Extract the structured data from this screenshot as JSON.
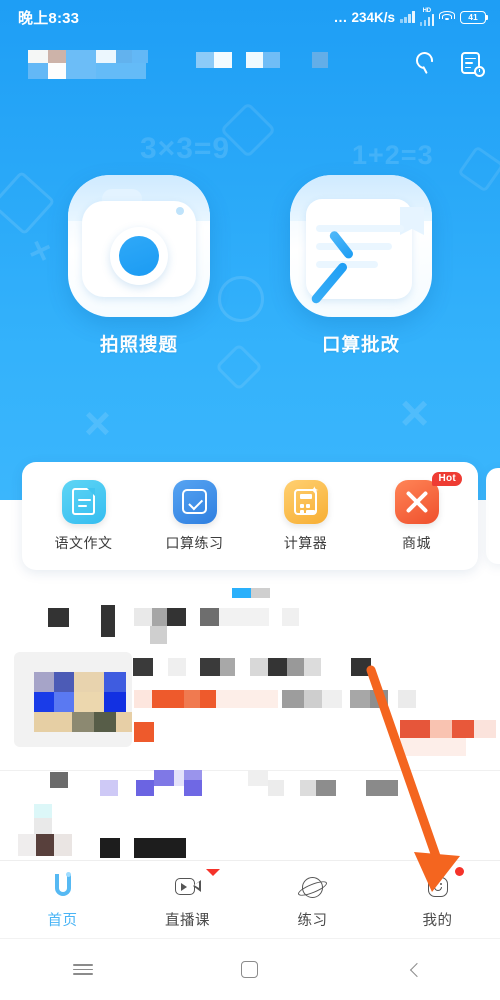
{
  "status_bar": {
    "time": "晚上8:33",
    "dots": "…",
    "network_speed": "234K/s",
    "hd_label": "HD",
    "battery_level": "41",
    "icons": [
      "signal-bars-icon",
      "hd-signal-icon",
      "wifi-icon",
      "battery-icon"
    ]
  },
  "header": {
    "title_censored": true,
    "search_icon": "search-icon",
    "history_icon": "history-document-icon"
  },
  "hero": {
    "background_color": "#29a8f8",
    "watermarks": {
      "equation_1": "3×3=9",
      "equation_2": "1+2=3",
      "symbol": "×"
    },
    "entries": [
      {
        "label": "拍照搜题",
        "icon": "camera-icon"
      },
      {
        "label": "口算批改",
        "icon": "check-paper-icon"
      }
    ]
  },
  "shortcuts": [
    {
      "label": "语文作文",
      "icon": "document-icon",
      "color": "#41c4f0",
      "badge": ""
    },
    {
      "label": "口算练习",
      "icon": "checkbox-icon",
      "color": "#3a8ce8",
      "badge": ""
    },
    {
      "label": "计算器",
      "icon": "calculator-icon",
      "color": "#fcbc3f",
      "badge": ""
    },
    {
      "label": "商城",
      "icon": "cross-tools-icon",
      "color": "#f4623a",
      "badge": "Hot"
    }
  ],
  "feed": {
    "censored": true,
    "note": "mosaic-blurred content area",
    "tab_indicator_active_color": "#2ab0fb",
    "tab_indicator_inactive_color": "#cfcfcf"
  },
  "bottom_tabs": [
    {
      "label": "首页",
      "icon": "home-icon",
      "active": true,
      "badge": "none"
    },
    {
      "label": "直播课",
      "icon": "live-video-icon",
      "active": false,
      "badge": "triangle"
    },
    {
      "label": "练习",
      "icon": "planet-icon",
      "active": false,
      "badge": "none"
    },
    {
      "label": "我的",
      "icon": "smiley-face-icon",
      "active": false,
      "badge": "dot"
    }
  ],
  "annotation": {
    "arrow_color": "#f4651f",
    "points_to": "我的"
  },
  "system_nav": {
    "menu": "menu-icon",
    "home": "home-square-icon",
    "back": "back-chevron-icon"
  },
  "colors": {
    "brand_blue": "#29a8f8",
    "active_tab": "#49b4f5",
    "badge_red": "#ee3c33",
    "arrow_orange": "#f4651f"
  }
}
